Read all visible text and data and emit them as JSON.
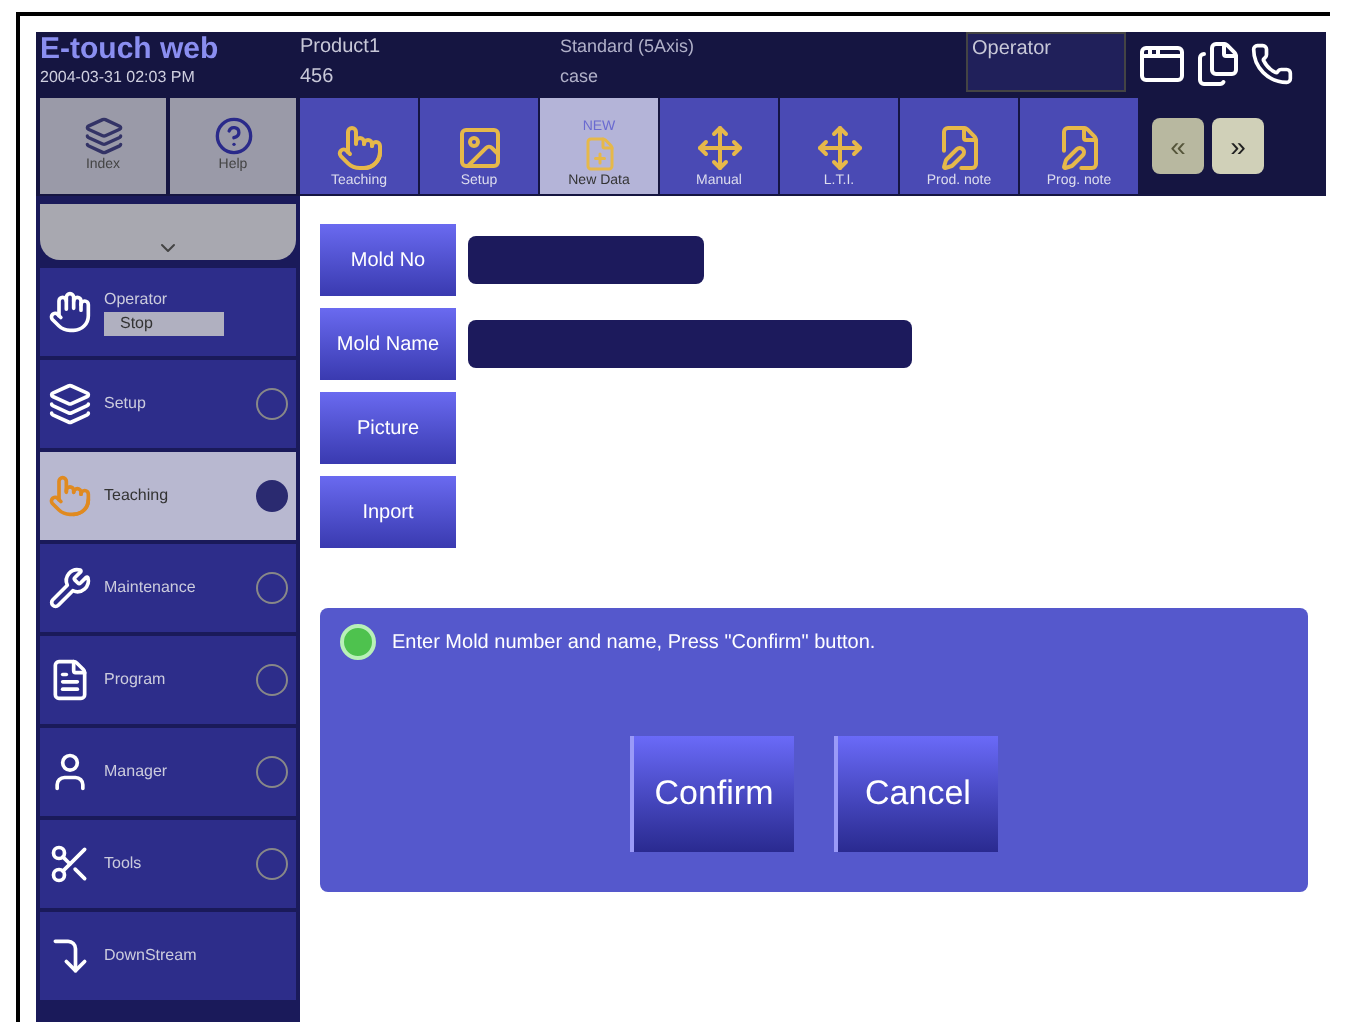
{
  "header": {
    "logo": "E-touch web",
    "datetime": "2004-03-31 02:03 PM",
    "product": "Product1",
    "mold_number": "456",
    "standard": "Standard (5Axis)",
    "case": "case",
    "user": "Operator"
  },
  "top_buttons": [
    {
      "label": "Index"
    },
    {
      "label": "Help"
    }
  ],
  "toolbar": [
    {
      "label": "Teaching",
      "selected": false
    },
    {
      "label": "Setup",
      "selected": false
    },
    {
      "label": "New Data",
      "badge": "NEW",
      "selected": true
    },
    {
      "label": "Manual",
      "selected": false
    },
    {
      "label": "L.T.I.",
      "selected": false
    },
    {
      "label": "Prod. note",
      "selected": false
    },
    {
      "label": "Prog. note",
      "selected": false
    }
  ],
  "pager": [
    "«",
    "»"
  ],
  "sidebar": [
    {
      "kind": "status",
      "label": "Operator",
      "status": "Stop",
      "selected": false
    },
    {
      "kind": "menu",
      "label": "Setup",
      "selected": false
    },
    {
      "kind": "menu",
      "label": "Teaching",
      "selected": true
    },
    {
      "kind": "menu",
      "label": "Maintenance",
      "selected": false
    },
    {
      "kind": "menu",
      "label": "Program",
      "selected": false
    },
    {
      "kind": "menu",
      "label": "Manager",
      "selected": false
    },
    {
      "kind": "menu",
      "label": "Tools",
      "selected": false
    },
    {
      "kind": "plain",
      "label": "DownStream",
      "selected": false
    }
  ],
  "form": [
    {
      "kind": "narrow",
      "label": "Mold No"
    },
    {
      "kind": "wide",
      "label": "Mold Name"
    },
    {
      "kind": "plain",
      "label": "Picture"
    },
    {
      "kind": "plain",
      "label": "Inport"
    }
  ],
  "message": {
    "text": "Enter Mold number and name, Press \"Confirm\" button.",
    "buttons": [
      "Confirm",
      "Cancel"
    ]
  }
}
